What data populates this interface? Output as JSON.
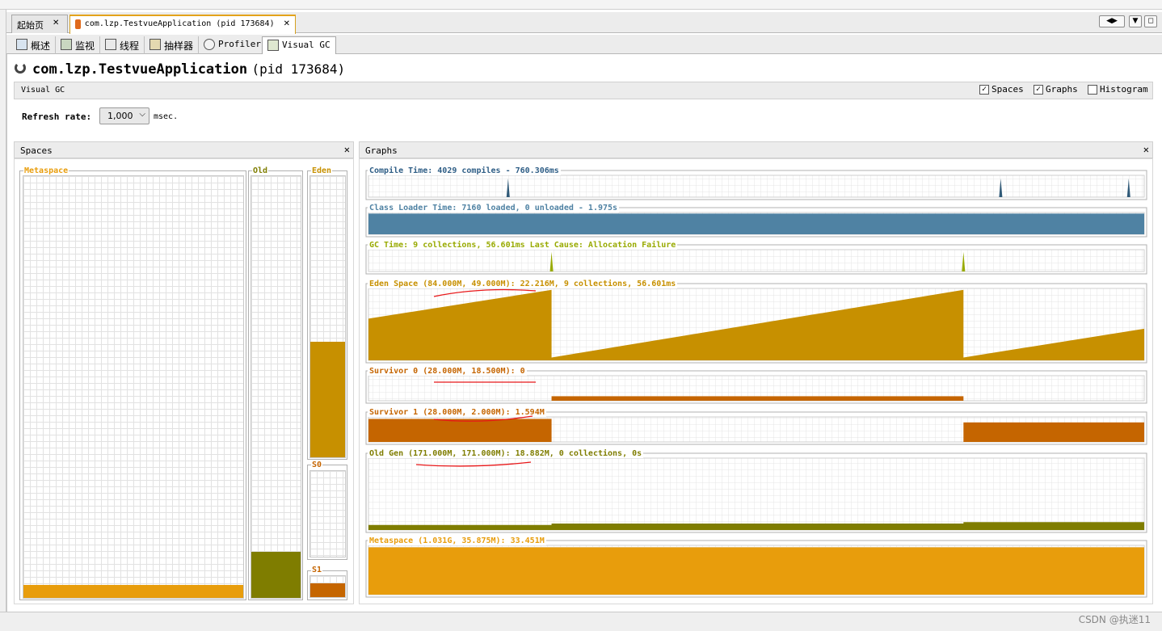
{
  "doc_tabs": [
    {
      "label": "起始页",
      "close": "✕",
      "active": false
    },
    {
      "label": "com.lzp.TestvueApplication (pid 173684)",
      "close": "✕",
      "active": true
    }
  ],
  "nav_arrows": {
    "left": "◀",
    "right": "▶",
    "menu": "▼",
    "restore": "◻"
  },
  "sub_tabs": [
    {
      "label": "概述",
      "icon": "overview-icon"
    },
    {
      "label": "监视",
      "icon": "monitor-icon"
    },
    {
      "label": "线程",
      "icon": "threads-icon"
    },
    {
      "label": "抽样器",
      "icon": "sampler-icon"
    },
    {
      "label": "Profiler",
      "icon": "profiler-icon"
    },
    {
      "label": "Visual GC",
      "icon": "visual-gc-icon",
      "active": true
    }
  ],
  "app": {
    "name": "com.lzp.TestvueApplication",
    "pid": "(pid 173684)"
  },
  "visual_gc_bar": {
    "title": "Visual GC",
    "options": [
      {
        "label": "Spaces",
        "checked": true
      },
      {
        "label": "Graphs",
        "checked": true
      },
      {
        "label": "Histogram",
        "checked": false
      }
    ]
  },
  "refresh": {
    "label": "Refresh rate:",
    "value": "1,000",
    "unit": "msec."
  },
  "spaces_panel": {
    "title": "Spaces",
    "close": "✕"
  },
  "graphs_panel": {
    "title": "Graphs",
    "close": "✕"
  },
  "colors": {
    "metaspace": "#e89d0c",
    "old": "#7f7d00",
    "eden": "#c79000",
    "survivor": "#c56500",
    "compile": "#305a78",
    "classloader": "#4f82a3",
    "gc": "#98aa00",
    "label_blue": "#2f5e86",
    "annot": "#e8181a"
  },
  "chart_data": [
    {
      "type": "bar",
      "title": "Spaces",
      "categories": [
        "Metaspace",
        "Old",
        "Eden",
        "S0",
        "S1"
      ],
      "fill_fraction": [
        0.03,
        0.11,
        0.41,
        0.0,
        0.67
      ]
    },
    {
      "type": "line",
      "series": [
        {
          "name": "Compile Time",
          "label": "Compile Time: 4029 compiles - 760.306ms",
          "spikes_at": [
            0.18,
            0.815,
            0.98
          ]
        },
        {
          "name": "Class Loader Time",
          "label": "Class Loader Time: 7160 loaded, 0 unloaded - 1.975s",
          "level": 0.95
        },
        {
          "name": "GC Time",
          "label": "GC Time: 9 collections, 56.601ms Last Cause: Allocation Failure",
          "spikes_at": [
            0.236,
            0.767
          ]
        },
        {
          "name": "Eden Space",
          "label": "Eden Space (84.000M, 49.000M): 22.216M, 9 collections, 56.601ms"
        },
        {
          "name": "Survivor 0",
          "label": "Survivor 0 (28.000M, 18.500M): 0"
        },
        {
          "name": "Survivor 1",
          "label": "Survivor 1 (28.000M, 2.000M): 1.594M"
        },
        {
          "name": "Old Gen",
          "label": "Old Gen (171.000M, 171.000M): 18.882M, 0 collections, 0s"
        },
        {
          "name": "Metaspace",
          "label": "Metaspace (1.031G, 35.875M): 33.451M",
          "level": 0.96
        }
      ]
    }
  ],
  "watermark": "CSDN @执迷11"
}
